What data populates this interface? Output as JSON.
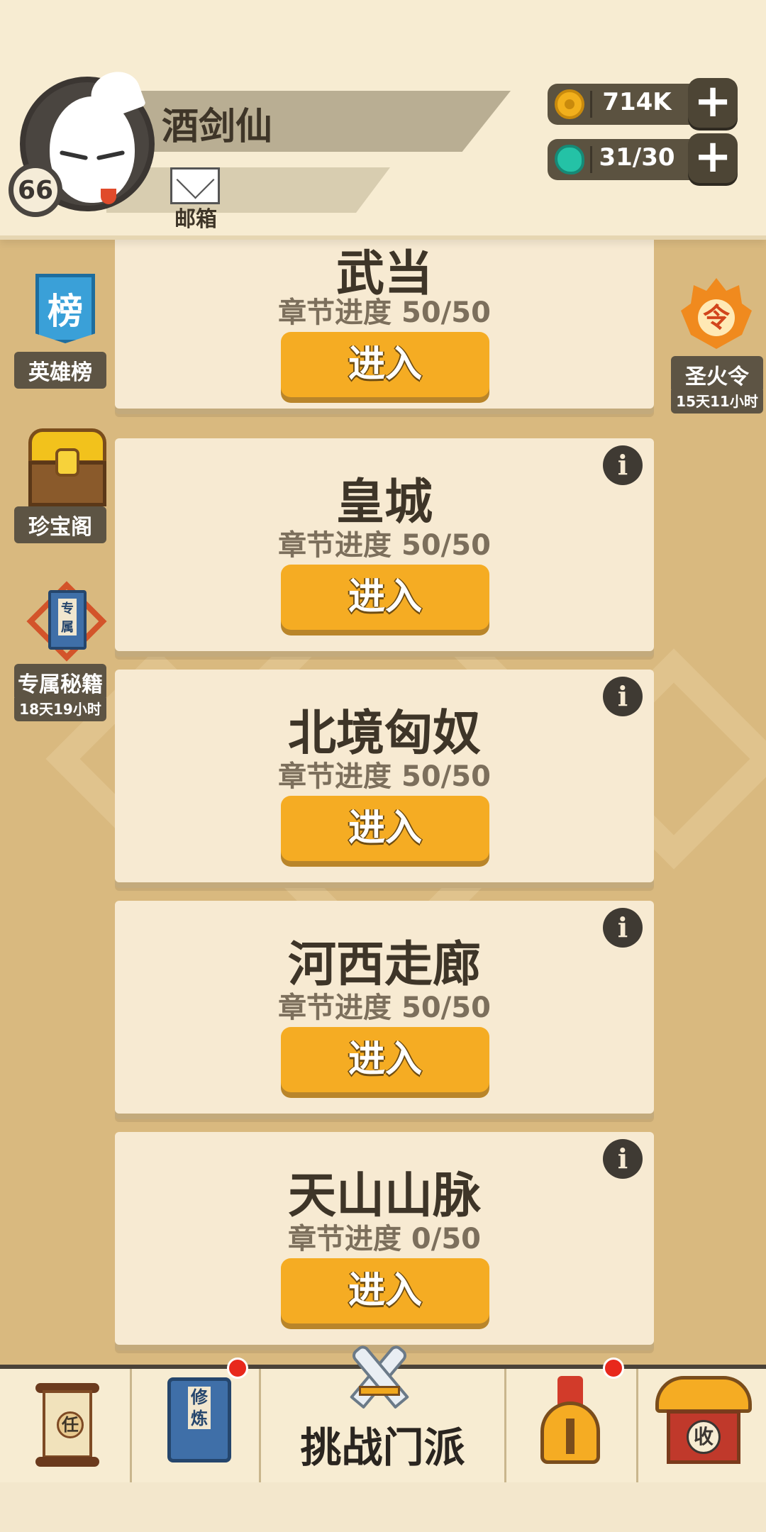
{
  "player": {
    "name": "酒剑仙",
    "level": "66",
    "mailbox_label": "邮箱"
  },
  "currencies": [
    {
      "icon": "coin-icon",
      "value": "714K"
    },
    {
      "icon": "gem-icon",
      "value": "31/30"
    }
  ],
  "plus_symbol": "+",
  "side_left": [
    {
      "label": "英雄榜",
      "icon_text": "榜"
    },
    {
      "label": "珍宝阁"
    },
    {
      "label": "专属秘籍",
      "timer": "18天19小时",
      "icon_text": "专属"
    }
  ],
  "side_right": {
    "label": "圣火令",
    "timer": "15天11小时",
    "icon_text": "令"
  },
  "cards": [
    {
      "title": "武当",
      "progress": "章节进度 50/50",
      "button": "进入"
    },
    {
      "title": "皇城",
      "progress": "章节进度 50/50",
      "button": "进入"
    },
    {
      "title": "北境匈奴",
      "progress": "章节进度 50/50",
      "button": "进入"
    },
    {
      "title": "河西走廊",
      "progress": "章节进度 50/50",
      "button": "进入"
    },
    {
      "title": "天山山脉",
      "progress": "章节进度 0/50",
      "button": "进入"
    }
  ],
  "info_symbol": "i",
  "bottom_nav": {
    "task_icon_text": "任",
    "train_icon_text": "修炼",
    "challenge_label": "挑战门派",
    "shop_icon_text": "收"
  },
  "colors": {
    "background": "#d9b97f",
    "card": "#f7ead2",
    "enter_button": "#f5ac23",
    "notification_dot": "#e8281c"
  }
}
